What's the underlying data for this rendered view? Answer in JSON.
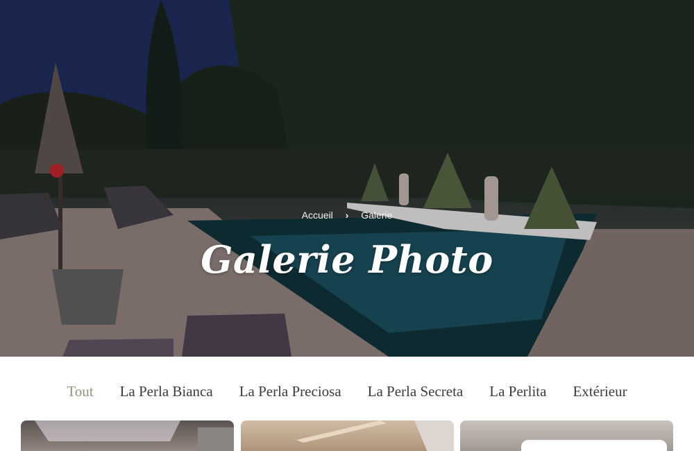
{
  "hero": {
    "breadcrumb": {
      "home_label": "Accueil",
      "separator_icon": "chevron-right-icon",
      "current_label": "Galerie"
    },
    "title": "Galerie Photo"
  },
  "filters": {
    "active_color": "#8c9a79",
    "items": [
      {
        "label": "Tout",
        "active": true
      },
      {
        "label": "La Perla Bianca",
        "active": false
      },
      {
        "label": "La Perla Preciosa",
        "active": false
      },
      {
        "label": "La Perla Secreta",
        "active": false
      },
      {
        "label": "La Perlita",
        "active": false
      },
      {
        "label": "Extérieur",
        "active": false
      }
    ]
  }
}
